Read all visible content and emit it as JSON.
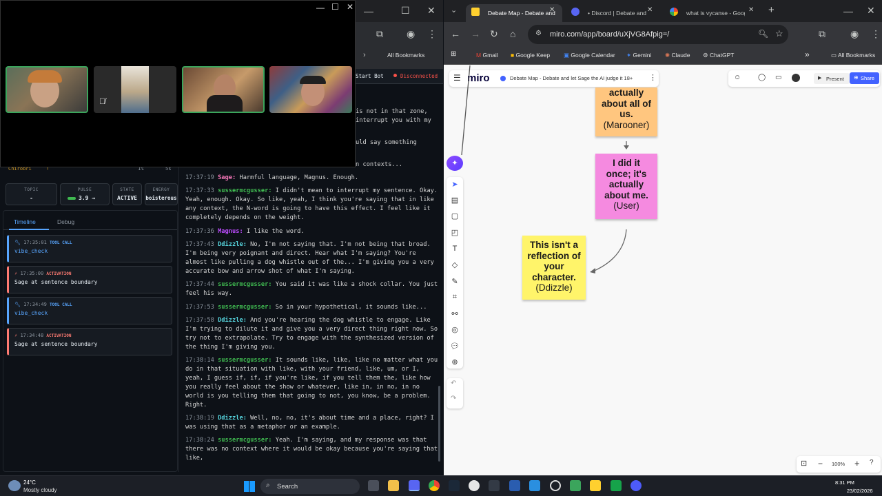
{
  "left_window": {
    "pulse_row": {
      "user": "Chirobri",
      "flag": "!",
      "pct": "1%",
      "other": "5s"
    },
    "header_btns": {
      "start": "Start Bot",
      "status": "Disconnected"
    },
    "stats": [
      {
        "label": "TOPIC",
        "value": "-"
      },
      {
        "label": "PULSE",
        "value": "3.9 →"
      },
      {
        "label": "STATE",
        "value": "ACTIVE"
      },
      {
        "label": "ENERGY",
        "value": "boisterous"
      }
    ],
    "tabs": [
      "Timeline",
      "Debug"
    ],
    "timeline": [
      {
        "time": "17:35:01",
        "type": "TOOL CALL",
        "body": "vibe_check",
        "color": "#58a6ff"
      },
      {
        "time": "17:35:00",
        "type": "ACTIVATION",
        "body": "Sage at sentence boundary",
        "color": "#ff7b72"
      },
      {
        "time": "17:34:49",
        "type": "TOOL CALL",
        "body": "vibe_check",
        "color": "#58a6ff"
      },
      {
        "time": "17:34:48",
        "type": "ACTIVATION",
        "body": "Sage at sentence boundary",
        "color": "#ff7b72"
      }
    ],
    "partial_lines": [
      "is not in that zone,",
      "interrupt you with my",
      "uld say something",
      "n contexts..."
    ],
    "chat": [
      {
        "ts": "17:37:19",
        "user": "Sage:",
        "color": "#f778ba",
        "text": "Harmful language, Magnus. Enough."
      },
      {
        "ts": "17:37:33",
        "user": "sussermcgusser:",
        "color": "#3fb950",
        "text": "I didn't mean to interrupt my sentence. Okay. Yeah, enough. Okay. So like, yeah, I think you're saying that in like any context, the N-word is going to have this effect. I feel like it completely depends on the weight."
      },
      {
        "ts": "17:37:36",
        "user": "Magnus:",
        "color": "#bc4cff",
        "text": "I like the word."
      },
      {
        "ts": "17:37:43",
        "user": "Ddizzle:",
        "color": "#56d4dd",
        "text": "No, I'm not saying that. I'm not being that broad. I'm being very poignant and direct. Hear what I'm saying? You're almost like pulling a dog whistle out of the... I'm giving you a very accurate bow and arrow shot of what I'm saying."
      },
      {
        "ts": "17:37:44",
        "user": "sussermcgusser:",
        "color": "#3fb950",
        "text": "You said it was like a shock collar. You just feel his way."
      },
      {
        "ts": "17:37:53",
        "user": "sussermcgusser:",
        "color": "#3fb950",
        "text": "So in your hypothetical, it sounds like..."
      },
      {
        "ts": "17:37:58",
        "user": "Ddizzle:",
        "color": "#56d4dd",
        "text": "And you're hearing the dog whistle to engage. Like I'm trying to dilute it and give you a very direct thing right now. So try not to extrapolate. Try to engage with the synthesized version of the thing I'm giving you."
      },
      {
        "ts": "17:38:14",
        "user": "sussermcgusser:",
        "color": "#3fb950",
        "text": "It sounds like, like, like no matter what you do in that situation with like, with your friend, like, um, or I, yeah, I guess if, if, if you're like, if you tell them the, like how you really feel about the show or whatever, like in, in no, in no world is you telling them that going to not, you know, be a problem. Right."
      },
      {
        "ts": "17:38:19",
        "user": "Ddizzle:",
        "color": "#56d4dd",
        "text": "Well, no, no, it's about time and a place, right? I was using that as a metaphor or an example."
      },
      {
        "ts": "17:38:24",
        "user": "sussermcgusser:",
        "color": "#3fb950",
        "text": "Yeah. I'm saying, and my response was that there was no context where it would be okay because you're saying that like,"
      }
    ],
    "bookmarks": "All Bookmarks"
  },
  "right_window": {
    "tabs": [
      {
        "title": "Debate Map - Debate and",
        "icon_color": "#ffd02f"
      },
      {
        "title": "• Discord | Debate and let",
        "icon_color": "#5865f2"
      },
      {
        "title": "what is vycanse - Google S",
        "icon_color": "#4285f4"
      }
    ],
    "url": "miro.com/app/board/uXjVG8Afpig=/",
    "bookmarks": [
      "Gmail",
      "Google Keep",
      "Google Calendar",
      "Gemini",
      "Claude",
      "ChatGPT"
    ],
    "all_bookmarks": "All Bookmarks",
    "miro": {
      "logo": "miro",
      "board_title": "Debate Map - Debate and let Sage the AI judge it 18+",
      "present": "Present",
      "share": "Share",
      "zoom": "100%",
      "notes": [
        {
          "bold": "actually about all of us.",
          "author": "(Marooner)",
          "color": "#ffc67f"
        },
        {
          "bold": "I did it once; it's actually about me.",
          "author": "(User)",
          "color": "#f58ae0"
        },
        {
          "bold": "This isn't a reflection of your character.",
          "author": "(Ddizzle)",
          "color": "#fff46a"
        }
      ]
    }
  },
  "taskbar": {
    "weather_temp": "24°C",
    "weather_desc": "Mostly cloudy",
    "search": "Search",
    "time": "8:31 PM",
    "date": "23/02/2026"
  }
}
